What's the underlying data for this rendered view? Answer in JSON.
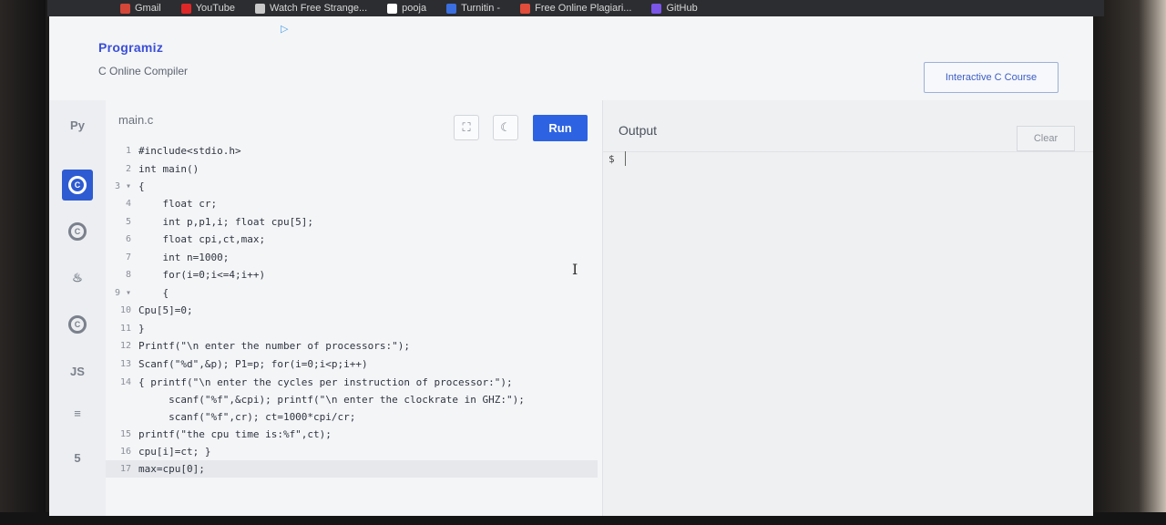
{
  "bookmarks": [
    {
      "label": "Gmail",
      "icon": "mail-icon",
      "color": "#d44638"
    },
    {
      "label": "YouTube",
      "icon": "youtube-icon",
      "color": "#e02727"
    },
    {
      "label": "Watch Free Strange...",
      "icon": "film-icon",
      "color": "#c9c9c9"
    },
    {
      "label": "pooja",
      "icon": "github-icon",
      "color": "#ffffff"
    },
    {
      "label": "Turnitin -",
      "icon": "turnitin-icon",
      "color": "#3b6fe0"
    },
    {
      "label": "Free Online Plagiari...",
      "icon": "check-icon",
      "color": "#e24c3a"
    },
    {
      "label": "GitHub",
      "icon": "github-icon",
      "color": "#7a55e8"
    }
  ],
  "header": {
    "logo": "Programiz",
    "subtitle": "C Online Compiler",
    "ad_icon": "play-ad-icon",
    "course_button": "Interactive C Course"
  },
  "sidebar": {
    "items": [
      {
        "name": "python",
        "icon": "python-icon",
        "glyph": "Py"
      },
      {
        "name": "c",
        "icon": "c-icon",
        "glyph": "C",
        "active": true
      },
      {
        "name": "cpp",
        "icon": "cpp-icon",
        "glyph": "C"
      },
      {
        "name": "java",
        "icon": "java-icon",
        "glyph": "♨"
      },
      {
        "name": "csharp",
        "icon": "csharp-icon",
        "glyph": "C"
      },
      {
        "name": "javascript",
        "icon": "js-icon",
        "glyph": "JS"
      },
      {
        "name": "sql",
        "icon": "database-icon",
        "glyph": "≡"
      },
      {
        "name": "html",
        "icon": "html-icon",
        "glyph": "5"
      }
    ]
  },
  "editor": {
    "filename": "main.c",
    "fullscreen_icon": "fullscreen-icon",
    "theme_icon": "moon-icon",
    "run_label": "Run",
    "lines": [
      {
        "n": "1",
        "text": "#include<stdio.h>"
      },
      {
        "n": "2",
        "text": "int main()"
      },
      {
        "n": "3 ▾",
        "text": "{"
      },
      {
        "n": "4",
        "text": "    float cr;"
      },
      {
        "n": "5",
        "text": "    int p,p1,i; float cpu[5];"
      },
      {
        "n": "6",
        "text": "    float cpi,ct,max;"
      },
      {
        "n": "7",
        "text": "    int n=1000;"
      },
      {
        "n": "8",
        "text": "    for(i=0;i<=4;i++)"
      },
      {
        "n": "9 ▾",
        "text": "    {"
      },
      {
        "n": "10",
        "text": "Cpu[5]=0;"
      },
      {
        "n": "11",
        "text": "}"
      },
      {
        "n": "12",
        "text": "Printf(\"\\n enter the number of processors:\");"
      },
      {
        "n": "13",
        "text": "Scanf(\"%d\",&p); P1=p; for(i=0;i<p;i++)"
      },
      {
        "n": "14",
        "text": "{ printf(\"\\n enter the cycles per instruction of processor:\");"
      },
      {
        "n": "",
        "text": "     scanf(\"%f\",&cpi); printf(\"\\n enter the clockrate in GHZ:\");"
      },
      {
        "n": "",
        "text": "     scanf(\"%f\",cr); ct=1000*cpi/cr;"
      },
      {
        "n": "15",
        "text": "printf(\"the cpu time is:%f\",ct);"
      },
      {
        "n": "16",
        "text": "cpu[i]=ct; }"
      },
      {
        "n": "17",
        "text": "max=cpu[0];"
      }
    ]
  },
  "output": {
    "title": "Output",
    "clear_label": "Clear",
    "prompt": "$"
  }
}
